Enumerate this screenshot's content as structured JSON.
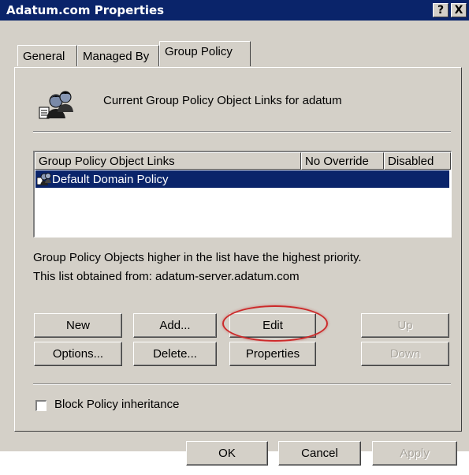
{
  "window": {
    "title": "Adatum.com  Properties",
    "help_glyph": "?",
    "close_glyph": "X"
  },
  "tabs": [
    {
      "label": "General"
    },
    {
      "label": "Managed By"
    },
    {
      "label": "Group Policy",
      "active": true
    }
  ],
  "header": {
    "icon": "group-users-icon",
    "text": "Current Group Policy Object Links for adatum"
  },
  "list": {
    "columns": [
      "Group Policy Object Links",
      "No Override",
      "Disabled"
    ],
    "rows": [
      {
        "name": "Default Domain Policy",
        "no_override": "",
        "disabled": "",
        "selected": true,
        "icon": "gpo-icon"
      }
    ]
  },
  "info": {
    "priority_note": "Group Policy Objects higher in the list have the highest priority.",
    "source_line": "This list obtained from: adatum-server.adatum.com"
  },
  "buttons": {
    "new": "New",
    "add": "Add...",
    "edit": "Edit",
    "up": "Up",
    "options": "Options...",
    "delete": "Delete...",
    "properties": "Properties",
    "down": "Down"
  },
  "checkbox": {
    "label": "Block Policy inheritance",
    "checked": false
  },
  "dialog_buttons": {
    "ok": "OK",
    "cancel": "Cancel",
    "apply": "Apply"
  },
  "colors": {
    "title_bar": "#0a246a",
    "selection": "#0a246a",
    "face": "#d4d0c8",
    "annotation": "#cc2a2a"
  }
}
